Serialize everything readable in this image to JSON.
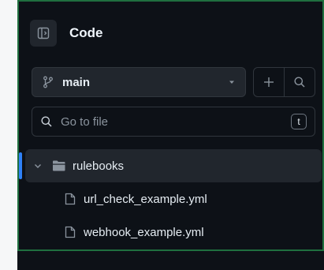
{
  "header": {
    "title": "Code",
    "panel_icon": "sidebar-toggle-icon"
  },
  "branch": {
    "selected": "main",
    "branch_icon": "git-branch-icon",
    "dropdown_icon": "triangle-down-icon",
    "add_icon": "plus-icon",
    "search_icon": "search-icon"
  },
  "search": {
    "placeholder": "Go to file",
    "shortcut": "t"
  },
  "tree": {
    "folder": {
      "name": "rulebooks",
      "expanded": true,
      "selected": true
    },
    "files": [
      {
        "name": "url_check_example.yml"
      },
      {
        "name": "webhook_example.yml"
      }
    ]
  },
  "colors": {
    "accent": "#2f81f7",
    "background": "#0d1117",
    "surface": "#21262d",
    "border": "#30363d",
    "text": "#e6edf3",
    "muted": "#8b949e"
  }
}
